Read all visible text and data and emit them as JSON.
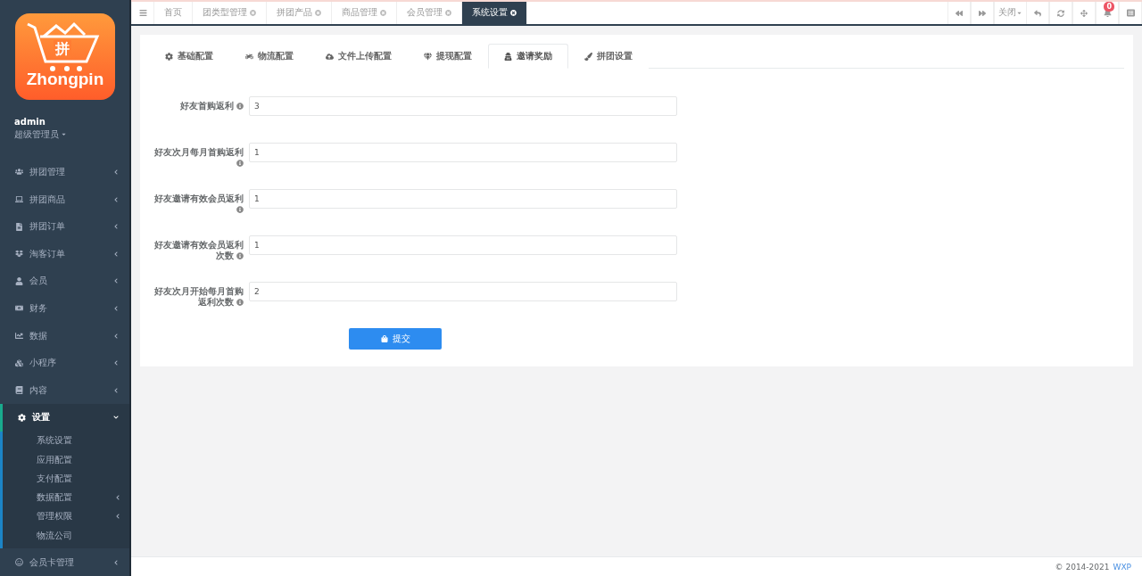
{
  "logo": {
    "glyph": "拼",
    "brand": "Zhongpin"
  },
  "user": {
    "name": "admin",
    "role": "超级管理员"
  },
  "sidebar": {
    "items": [
      {
        "label": "拼团管理",
        "expanded": false
      },
      {
        "label": "拼团商品",
        "expanded": false
      },
      {
        "label": "拼团订单",
        "expanded": false
      },
      {
        "label": "淘客订单",
        "expanded": false
      },
      {
        "label": "会员",
        "expanded": false
      },
      {
        "label": "财务",
        "expanded": false
      },
      {
        "label": "数据",
        "expanded": false
      },
      {
        "label": "小程序",
        "expanded": false
      },
      {
        "label": "内容",
        "expanded": false
      },
      {
        "label": "设置",
        "expanded": true,
        "children": [
          {
            "label": "系统设置",
            "kind": "link"
          },
          {
            "label": "应用配置",
            "kind": "link"
          },
          {
            "label": "支付配置",
            "kind": "link"
          },
          {
            "label": "数据配置",
            "kind": "group"
          },
          {
            "label": "管理权限",
            "kind": "group"
          },
          {
            "label": "物流公司",
            "kind": "link"
          }
        ]
      },
      {
        "label": "会员卡管理",
        "expanded": false
      }
    ]
  },
  "page_tabs": [
    {
      "label": "首页",
      "selected": false,
      "closable": false
    },
    {
      "label": "团类型管理",
      "selected": false,
      "closable": true
    },
    {
      "label": "拼团产品",
      "selected": false,
      "closable": true
    },
    {
      "label": "商品管理",
      "selected": false,
      "closable": true
    },
    {
      "label": "会员管理",
      "selected": false,
      "closable": true
    },
    {
      "label": "系统设置",
      "selected": true,
      "closable": true
    }
  ],
  "toolbar": {
    "close_menu": "关闭",
    "notification_count": "0"
  },
  "settings_tabs": [
    {
      "label": "基础配置",
      "selected": false
    },
    {
      "label": "物流配置",
      "selected": false
    },
    {
      "label": "文件上传配置",
      "selected": false
    },
    {
      "label": "提现配置",
      "selected": false
    },
    {
      "label": "邀请奖励",
      "selected": true
    },
    {
      "label": "拼团设置",
      "selected": false
    }
  ],
  "form": {
    "fields": [
      {
        "label": "好友首购返利",
        "value": "3"
      },
      {
        "label": "好友次月每月首购返利",
        "value": "1"
      },
      {
        "label": "好友邀请有效会员返利",
        "value": "1"
      },
      {
        "label": "好友邀请有效会员返利次数",
        "value": "1"
      },
      {
        "label": "好友次月开始每月首购返利次数",
        "value": "2"
      }
    ],
    "submit": "提交"
  },
  "footer": {
    "copyright": "© 2014-2021",
    "link": "WXP"
  }
}
